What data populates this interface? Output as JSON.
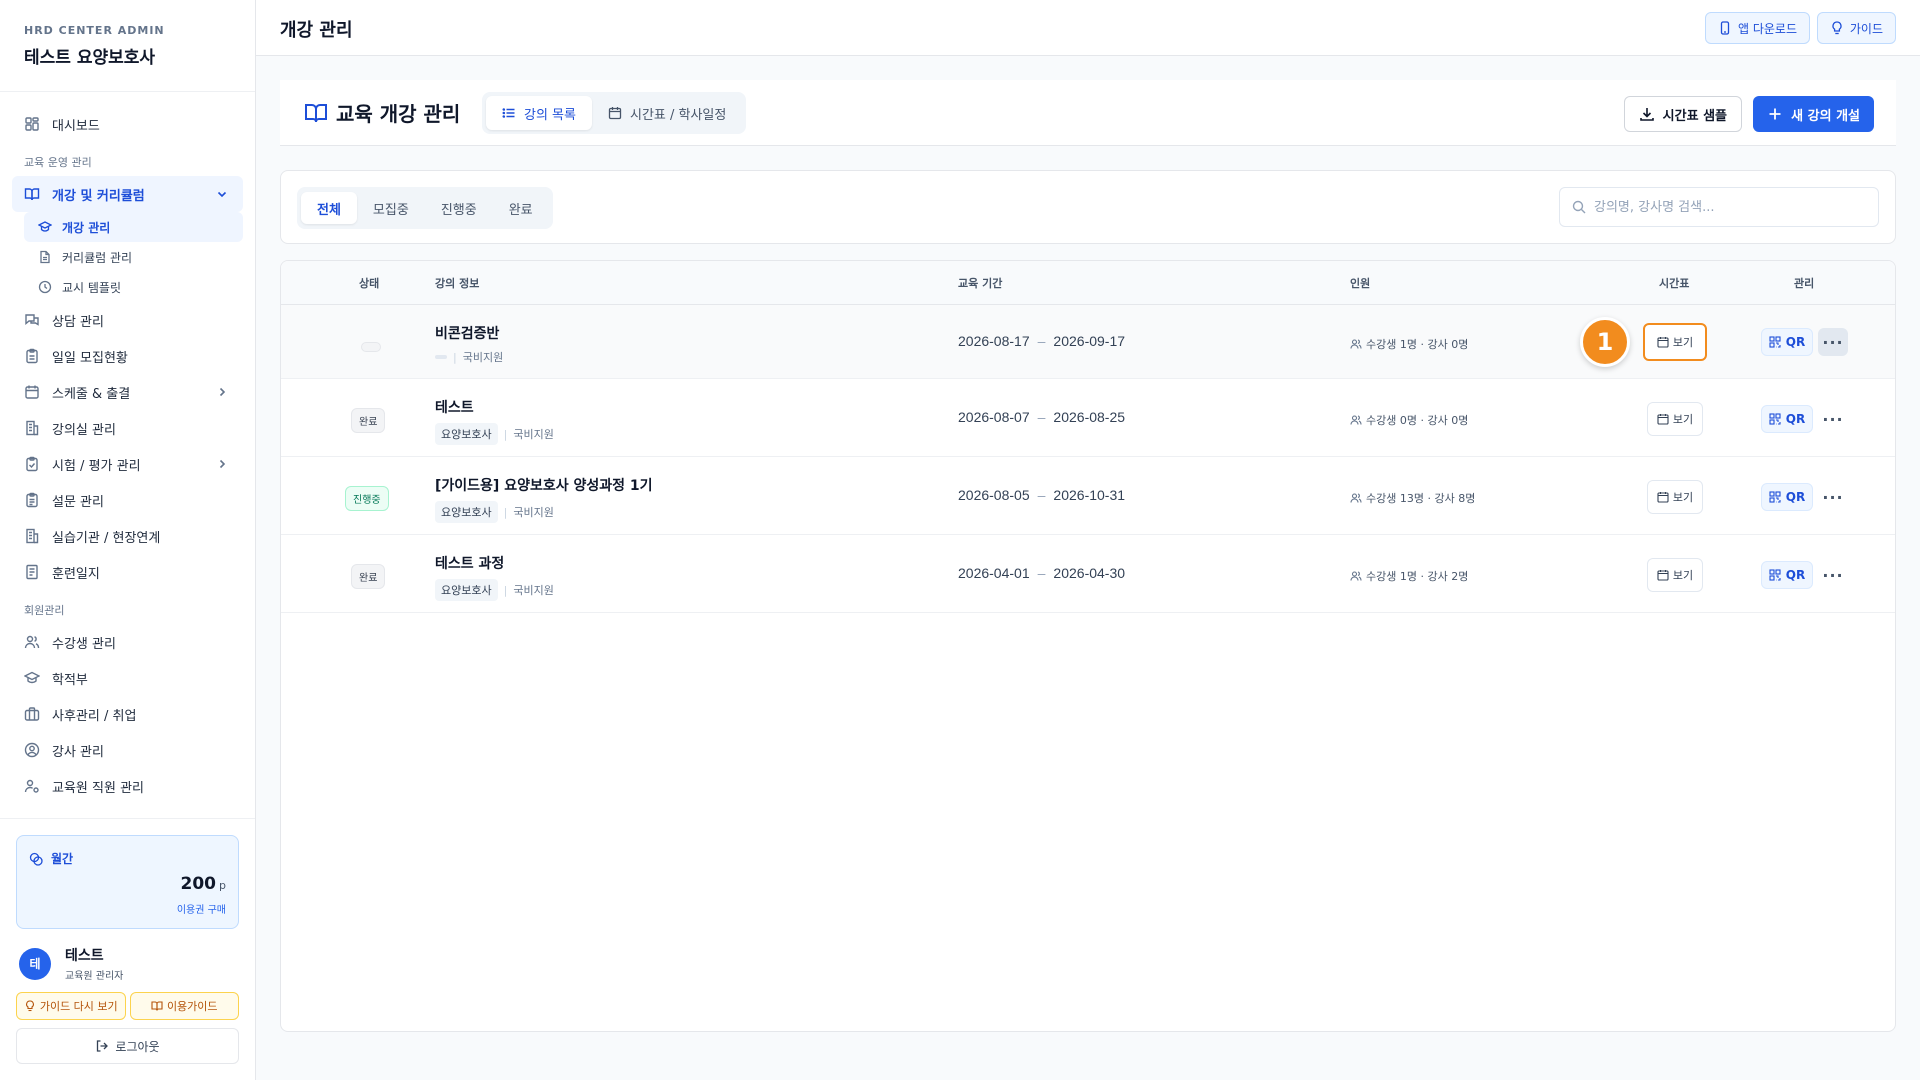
{
  "sidebar": {
    "eyebrow": "HRD CENTER ADMIN",
    "title": "테스트 요양보호사",
    "dashboard": "대시보드",
    "section_edu": "교육 운영 관리",
    "course_group": "개강 및 커리큘럼",
    "sub_items": [
      "개강 관리",
      "커리큘럼 관리",
      "교시 템플릿"
    ],
    "items_a": [
      "상담 관리",
      "일일 모집현황",
      "스케줄 & 출결",
      "강의실 관리",
      "시험 / 평가 관리",
      "설문 관리",
      "실습기관 / 현장연계",
      "훈련일지"
    ],
    "section_members": "회원관리",
    "items_b": [
      "수강생 관리",
      "학적부",
      "사후관리 / 취업",
      "강사 관리",
      "교육원 직원 관리"
    ],
    "points_label": "월간",
    "points_value": "200",
    "points_unit": "p",
    "points_link": "이용권 구매",
    "user_initial": "테",
    "user_name": "테스트",
    "user_role": "교육원 관리자",
    "guide_again": "가이드 다시 보기",
    "usage_guide": "이용가이드",
    "logout": "로그아웃"
  },
  "header": {
    "title": "개강 관리",
    "app_download": "앱 다운로드",
    "guide": "가이드"
  },
  "page": {
    "title": "교육 개강 관리",
    "tab_list": "강의 목록",
    "tab_schedule": "시간표 / 학사일정",
    "btn_sample": "시간표 샘플",
    "btn_new": "새 강의 개설"
  },
  "filters": {
    "tabs": [
      "전체",
      "모집중",
      "진행중",
      "완료"
    ],
    "search_placeholder": "강의명, 강사명 검색..."
  },
  "table": {
    "headers": {
      "status": "상태",
      "info": "강의 정보",
      "period": "교육 기간",
      "people": "인원",
      "timetable": "시간표",
      "manage": "관리"
    },
    "view_label": "보기",
    "qr_label": "QR",
    "more_label": "···",
    "rows": [
      {
        "status": "",
        "title": "비콘검증반",
        "tag": "",
        "funding": "국비지원",
        "start": "2026-08-17",
        "end": "2026-09-17",
        "students": "수강생 1명",
        "instructors": "· 강사 0명"
      },
      {
        "status": "완료",
        "title": "테스트",
        "tag": "요양보호사",
        "funding": "국비지원",
        "start": "2026-08-07",
        "end": "2026-08-25",
        "students": "수강생 0명",
        "instructors": "· 강사 0명"
      },
      {
        "status": "진행중",
        "title": "[가이드용] 요양보호사 양성과정 1기",
        "tag": "요양보호사",
        "funding": "국비지원",
        "start": "2026-08-05",
        "end": "2026-10-31",
        "students": "수강생 13명",
        "instructors": "· 강사 8명"
      },
      {
        "status": "완료",
        "title": "테스트 과정",
        "tag": "요양보호사",
        "funding": "국비지원",
        "start": "2026-04-01",
        "end": "2026-04-30",
        "students": "수강생 1명",
        "instructors": "· 강사 2명"
      }
    ],
    "separator": "|",
    "dash": "–"
  },
  "overlay": {
    "step_number": "1"
  },
  "colors": {
    "accent": "#2563eb",
    "highlight": "#f28c1e",
    "active_badge": "#047857"
  }
}
